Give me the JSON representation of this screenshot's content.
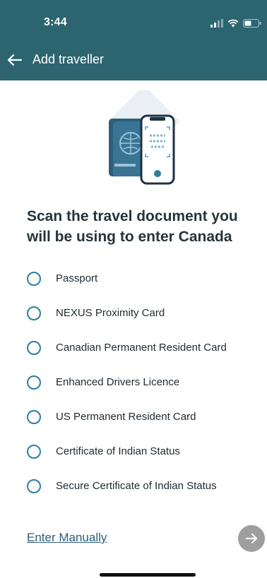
{
  "status": {
    "time": "3:44"
  },
  "header": {
    "title": "Add traveller"
  },
  "main": {
    "heading": "Scan the travel document you\nwill be using to enter Canada",
    "options": [
      "Passport",
      "NEXUS Proximity Card",
      "Canadian Permanent Resident Card",
      "Enhanced Drivers Licence",
      "US Permanent Resident Card",
      "Certificate of Indian Status",
      "Secure Certificate of Indian Status"
    ],
    "manual_link": "Enter Manually"
  },
  "icons": {
    "back": "arrow-left-icon",
    "next": "arrow-right-icon",
    "signal": "cellular-signal-icon",
    "wifi": "wifi-icon",
    "battery": "battery-icon"
  },
  "colors": {
    "header_bg": "#2c6570",
    "radio_border": "#2e7da0",
    "link": "#2d5f7a",
    "next_button": "#9e9e9e"
  }
}
